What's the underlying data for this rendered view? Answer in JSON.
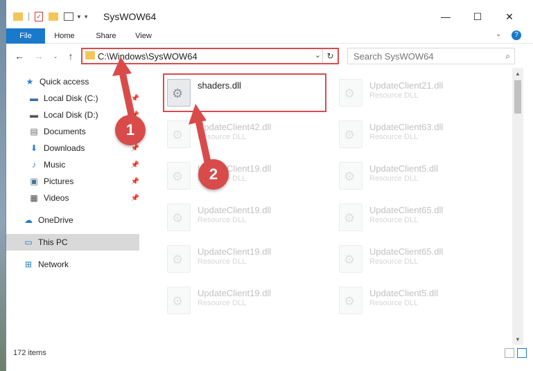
{
  "window": {
    "title": "SysWOW64",
    "minimize": "—",
    "maximize": "☐",
    "close": "✕"
  },
  "ribbon": {
    "tabs": [
      "File",
      "Home",
      "Share",
      "View"
    ]
  },
  "navbar": {
    "address_path": "C:\\Windows\\SysWOW64",
    "search_placeholder": "Search SysWOW64"
  },
  "sidebar": {
    "items": [
      {
        "label": "Quick access",
        "icon": "star-icon"
      },
      {
        "label": "Local Disk (C:)",
        "icon": "drive-icon"
      },
      {
        "label": "Local Disk (D:)",
        "icon": "drive-icon"
      },
      {
        "label": "Documents",
        "icon": "document-icon"
      },
      {
        "label": "Downloads",
        "icon": "download-icon"
      },
      {
        "label": "Music",
        "icon": "music-icon"
      },
      {
        "label": "Pictures",
        "icon": "pictures-icon"
      },
      {
        "label": "Videos",
        "icon": "video-icon"
      },
      {
        "label": "OneDrive",
        "icon": "cloud-icon"
      },
      {
        "label": "This PC",
        "icon": "monitor-icon"
      },
      {
        "label": "Network",
        "icon": "network-icon"
      }
    ]
  },
  "files": [
    {
      "name": "shaders.dll",
      "type": ""
    },
    {
      "name": "UpdateClient21.dll",
      "type": "Resource DLL"
    },
    {
      "name": "UpdateClient42.dll",
      "type": "Resource DLL"
    },
    {
      "name": "UpdateClient63.dll",
      "type": "Resource DLL"
    },
    {
      "name": "UpdateClient19.dll",
      "type": "Resource DLL"
    },
    {
      "name": "UpdateClient5.dll",
      "type": "Resource DLL"
    },
    {
      "name": "UpdateClient19.dll",
      "type": "Resource DLL"
    },
    {
      "name": "UpdateClient65.dll",
      "type": "Resource DLL"
    },
    {
      "name": "UpdateClient19.dll",
      "type": "Resource DLL"
    },
    {
      "name": "UpdateClient65.dll",
      "type": "Resource DLL"
    },
    {
      "name": "UpdateClient19.dll",
      "type": "Resource DLL"
    },
    {
      "name": "UpdateClient5.dll",
      "type": "Resource DLL"
    }
  ],
  "status": {
    "item_count": "172 items"
  },
  "annotations": {
    "step1": "1",
    "step2": "2",
    "color": "#d94b4b"
  }
}
